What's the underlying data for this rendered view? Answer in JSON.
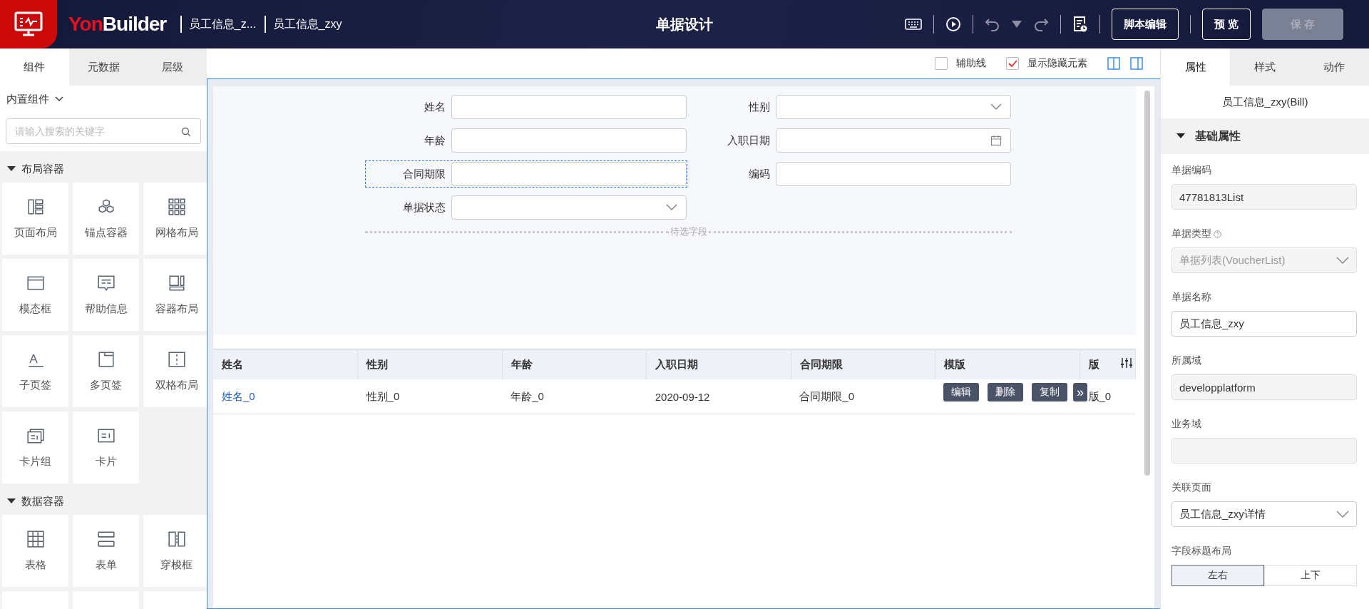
{
  "header": {
    "logo": {
      "prefix": "Yon",
      "suffix": "Builder"
    },
    "breadcrumbs": [
      "员工信息_z...",
      "员工信息_zxy"
    ],
    "title": "单据设计",
    "buttons": [
      {
        "label": "脚本编辑",
        "disabled": false
      },
      {
        "label": "预 览",
        "disabled": false
      },
      {
        "label": "保 存",
        "disabled": true
      }
    ]
  },
  "left_panel": {
    "tabs": [
      {
        "label": "组件",
        "selected": true
      },
      {
        "label": "元数据",
        "selected": false
      },
      {
        "label": "层级",
        "selected": false
      }
    ],
    "source": "内置组件",
    "search": {
      "placeholder": "请输入搜索的关键字"
    },
    "groups": [
      {
        "title": "布局容器",
        "expanded": true,
        "items": [
          {
            "label": "页面布局"
          },
          {
            "label": "锚点容器"
          },
          {
            "label": "网格布局"
          },
          {
            "label": "模态框"
          },
          {
            "label": "帮助信息"
          },
          {
            "label": "容器布局"
          },
          {
            "label": "子页签",
            "glyph": "A"
          },
          {
            "label": "多页签"
          },
          {
            "label": "双格布局"
          },
          {
            "label": "卡片组"
          },
          {
            "label": "卡片"
          }
        ]
      },
      {
        "title": "数据容器",
        "expanded": true,
        "items": [
          {
            "label": "表格"
          },
          {
            "label": "表单"
          },
          {
            "label": "穿梭框"
          }
        ]
      }
    ]
  },
  "canvas": {
    "options": [
      {
        "label": "辅助线",
        "checked": false
      },
      {
        "label": "显示隐藏元素",
        "checked": true
      }
    ],
    "form_fields": [
      {
        "label": "姓名",
        "kind": "text",
        "selected": false
      },
      {
        "label": "性别",
        "kind": "select",
        "selected": false
      },
      {
        "label": "年龄",
        "kind": "text",
        "selected": false
      },
      {
        "label": "入职日期",
        "kind": "date",
        "selected": false
      },
      {
        "label": "合同期限",
        "kind": "text",
        "selected": true
      },
      {
        "label": "编码",
        "kind": "text",
        "selected": false
      },
      {
        "label": "单据状态",
        "kind": "select",
        "selected": false
      }
    ],
    "pending_fields": "待选字段",
    "table": {
      "columns": [
        "姓名",
        "性别",
        "年龄",
        "入职日期",
        "合同期限",
        "模版",
        "版"
      ],
      "rows": [
        {
          "cells": [
            "姓名_0",
            "性别_0",
            "年龄_0",
            "2020-09-12",
            "合同期限_0",
            "",
            "版_0"
          ]
        }
      ],
      "row_actions": [
        "编辑",
        "删除",
        "复制"
      ],
      "more_actions": "»"
    }
  },
  "right_panel": {
    "tabs": [
      {
        "label": "属性",
        "selected": true
      },
      {
        "label": "样式",
        "selected": false
      },
      {
        "label": "动作",
        "selected": false
      }
    ],
    "object_title": "员工信息_zxy(Bill)",
    "section": {
      "title": "基础属性",
      "expanded": true
    },
    "properties": [
      {
        "label": "单据编码",
        "kind": "readonly",
        "value": "47781813List"
      },
      {
        "label": "单据类型",
        "kind": "select",
        "value": "单据列表(VoucherList)",
        "disabled": true,
        "help": true
      },
      {
        "label": "单据名称",
        "kind": "input",
        "value": "员工信息_zxy"
      },
      {
        "label": "所属域",
        "kind": "readonly",
        "value": "developplatform"
      },
      {
        "label": "业务域",
        "kind": "readonly"
      },
      {
        "label": "关联页面",
        "kind": "select",
        "value": "员工信息_zxy详情",
        "disabled": false
      },
      {
        "label": "字段标题布局",
        "kind": "segmented",
        "options": [
          {
            "label": "左右",
            "selected": true
          },
          {
            "label": "上下",
            "selected": false
          }
        ]
      }
    ]
  }
}
